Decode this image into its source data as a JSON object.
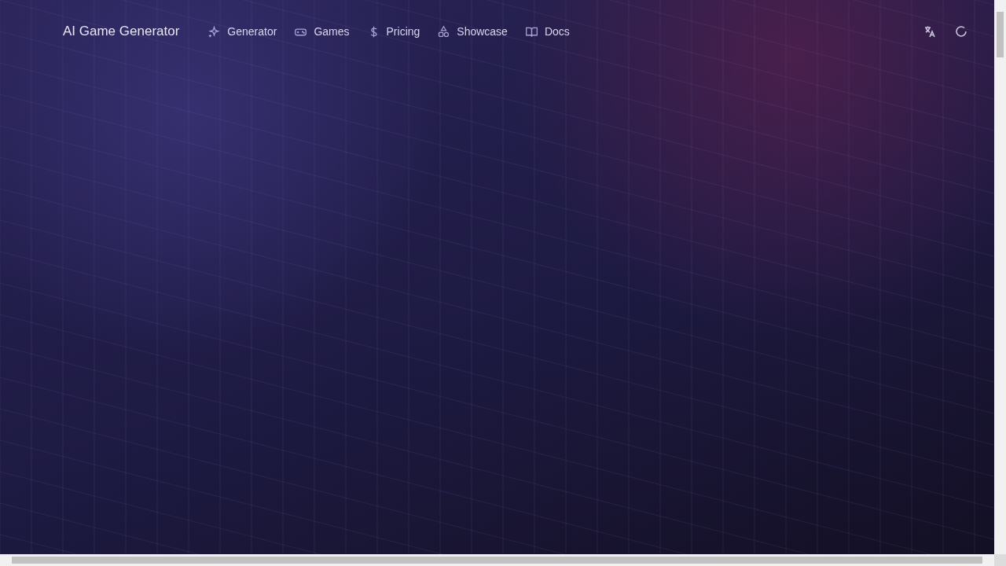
{
  "header": {
    "logo": "AI Game Generator",
    "nav": [
      {
        "label": "Generator",
        "kind": "sparkles"
      },
      {
        "label": "Games",
        "kind": "gamepad"
      },
      {
        "label": "Pricing",
        "kind": "dollar"
      },
      {
        "label": "Showcase",
        "kind": "shapes"
      },
      {
        "label": "Docs",
        "kind": "book"
      }
    ]
  }
}
